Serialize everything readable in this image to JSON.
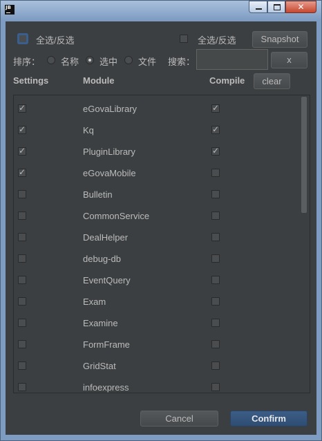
{
  "titlebar": {
    "app_icon": "JB",
    "icons": [
      "minimize-icon",
      "maximize-icon",
      "close-icon"
    ],
    "close_glyph": "✕"
  },
  "top": {
    "select_all_left": "全选/反选",
    "select_all_right": "全选/反选",
    "snapshot": "Snapshot"
  },
  "sort": {
    "label": "排序：",
    "options": [
      {
        "label": "名称",
        "selected": false
      },
      {
        "label": "选中",
        "selected": true
      },
      {
        "label": "文件",
        "selected": false
      }
    ],
    "search_label": "搜索：",
    "search_value": "",
    "clear_search": "x"
  },
  "headers": {
    "settings": "Settings",
    "module": "Module",
    "compile": "Compile",
    "clear": "clear"
  },
  "modules": [
    {
      "name": "eGovaLibrary",
      "settings": true,
      "compile": true
    },
    {
      "name": "Kq",
      "settings": true,
      "compile": true
    },
    {
      "name": "PluginLibrary",
      "settings": true,
      "compile": true
    },
    {
      "name": "eGovaMobile",
      "settings": true,
      "compile": false
    },
    {
      "name": "Bulletin",
      "settings": false,
      "compile": false
    },
    {
      "name": "CommonService",
      "settings": false,
      "compile": false
    },
    {
      "name": "DealHelper",
      "settings": false,
      "compile": false
    },
    {
      "name": "debug-db",
      "settings": false,
      "compile": false
    },
    {
      "name": "EventQuery",
      "settings": false,
      "compile": false
    },
    {
      "name": "Exam",
      "settings": false,
      "compile": false
    },
    {
      "name": "Examine",
      "settings": false,
      "compile": false
    },
    {
      "name": "FormFrame",
      "settings": false,
      "compile": false
    },
    {
      "name": "GridStat",
      "settings": false,
      "compile": false
    },
    {
      "name": "infoexpress",
      "settings": false,
      "compile": false
    }
  ],
  "footer": {
    "cancel": "Cancel",
    "confirm": "Confirm"
  },
  "colors": {
    "background": "#3c3f41",
    "text": "#bbbbbb",
    "primary_button": "#2f4d73",
    "window_frame": "#7e9cc2"
  }
}
